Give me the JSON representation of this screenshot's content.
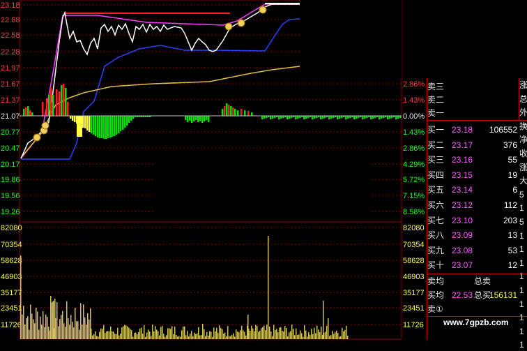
{
  "window": {
    "mode_marks": "× ×"
  },
  "price_axis_left": [
    "23.18",
    "22.88",
    "22.58",
    "22.28",
    "21.97",
    "21.67",
    "21.37",
    "21.07",
    "20.77",
    "20.47",
    "20.17",
    "19.86",
    "19.56",
    "19.26"
  ],
  "pct_axis_right": [
    "2.86%",
    "1.43%",
    "0.00%",
    "1.43%",
    "2.86%",
    "4.29%",
    "5.72%",
    "7.15%",
    "8.58%"
  ],
  "volume_axis": [
    "82080",
    "70354",
    "58628",
    "46903",
    "35177",
    "23451",
    "11726"
  ],
  "order_book": {
    "asks": [
      {
        "label": "卖三",
        "price": "",
        "vol": ""
      },
      {
        "label": "卖二",
        "price": "",
        "vol": ""
      },
      {
        "label": "卖一",
        "price": "",
        "vol": ""
      }
    ],
    "bids": [
      {
        "label": "买一",
        "price": "23.18",
        "vol": "106552"
      },
      {
        "label": "买二",
        "price": "23.17",
        "vol": "376"
      },
      {
        "label": "买三",
        "price": "23.16",
        "vol": "55"
      },
      {
        "label": "买四",
        "price": "23.15",
        "vol": "19"
      },
      {
        "label": "买五",
        "price": "23.14",
        "vol": "6"
      },
      {
        "label": "买六",
        "price": "23.12",
        "vol": "112"
      },
      {
        "label": "买七",
        "price": "23.10",
        "vol": "203"
      },
      {
        "label": "买八",
        "price": "23.09",
        "vol": "13"
      },
      {
        "label": "买九",
        "price": "23.08",
        "vol": "53"
      },
      {
        "label": "买十",
        "price": "23.07",
        "vol": "12"
      }
    ],
    "summary": {
      "sell_avg_label": "卖均",
      "total_sell_label": "总卖",
      "total_sell": "",
      "buy_avg_label": "买均",
      "buy_avg": "22.53",
      "total_buy_label": "总买",
      "total_buy": "156131",
      "sell_count_label": "卖①"
    }
  },
  "side_labels": [
    "涨",
    "总",
    "外",
    "换",
    "净",
    "收",
    "涨",
    "大",
    "5",
    "1",
    "5",
    "1",
    "1",
    "1",
    "1",
    "1",
    "1",
    "1",
    "1",
    "1"
  ],
  "watermark": "www.7gpzb.com",
  "colors": {
    "up": "#ff2020",
    "down": "#00e000",
    "yellow": "#ffff40",
    "price_line": "#ffffff",
    "avg_line": "#e0c040",
    "ma_line": "#3040ff",
    "limit_line": "#ff3cff",
    "grid": "#8b0000"
  },
  "chart_data": {
    "type": "line",
    "y_price_range": [
      19.26,
      23.18
    ],
    "prev_close": 21.07,
    "volume_range": [
      0,
      82080
    ]
  }
}
